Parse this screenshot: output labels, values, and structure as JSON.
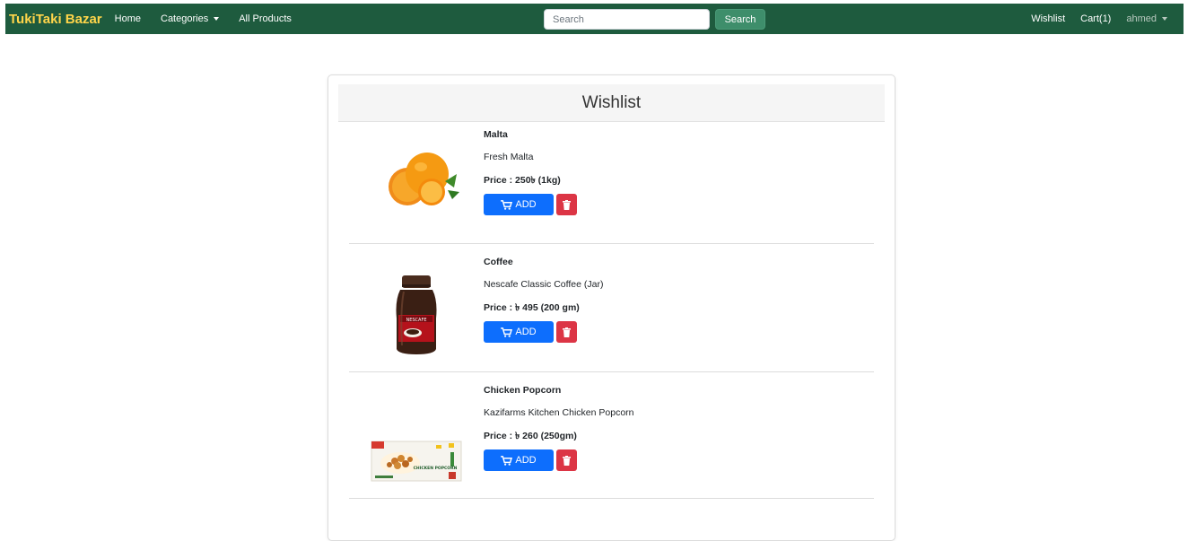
{
  "navbar": {
    "brand": "TukiTaki Bazar",
    "links": {
      "home": "Home",
      "categories": "Categories",
      "all_products": "All Products"
    },
    "search": {
      "placeholder": "Search",
      "button": "Search"
    },
    "right": {
      "wishlist": "Wishlist",
      "cart": "Cart(1)",
      "user": "ahmed"
    }
  },
  "wishlist": {
    "title": "Wishlist",
    "items": [
      {
        "name": "Malta",
        "description": "Fresh Malta",
        "price": "Price : 250৳ (1kg)",
        "add_label": "ADD",
        "image": "orange-image"
      },
      {
        "name": "Coffee",
        "description": "Nescafe Classic Coffee (Jar)",
        "price": "Price : ৳ 495 (200 gm)",
        "add_label": "ADD",
        "image": "coffee-jar-image"
      },
      {
        "name": "Chicken Popcorn",
        "description": "Kazifarms Kitchen Chicken Popcorn",
        "price": "Price : ৳ 260 (250gm)",
        "add_label": "ADD",
        "image": "popcorn-box-image"
      }
    ]
  },
  "image_labels": {
    "coffee_brand": "NESCAFE",
    "popcorn_box": "CHICKEN POPCORN"
  },
  "colors": {
    "navbar": "#1e5b3e",
    "brand": "#ffd54a",
    "add_button": "#0d6efd",
    "delete_button": "#dc3545",
    "search_button": "#3e8e6b"
  }
}
